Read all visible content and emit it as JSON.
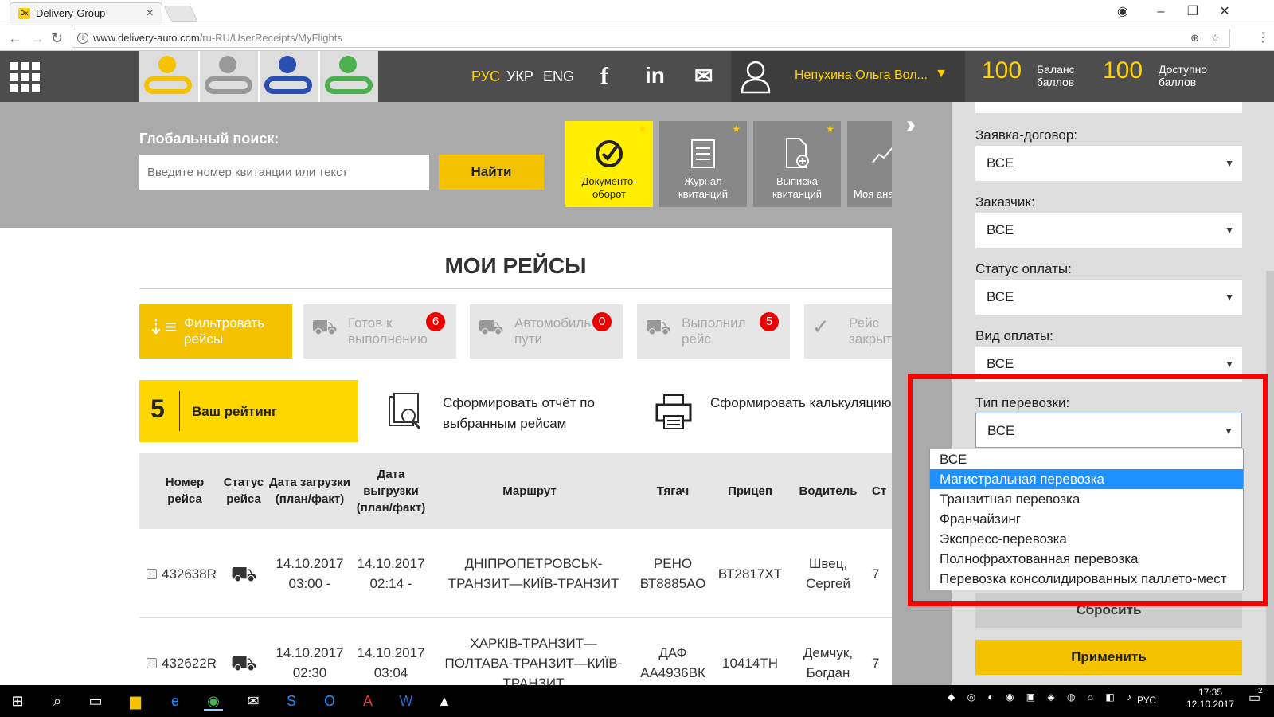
{
  "browser": {
    "tab_title": "Delivery-Group",
    "favicon": "Dx",
    "url_host": "www.delivery-auto.com",
    "url_path": "/ru-RU/UserReceipts/MyFlights"
  },
  "header": {
    "languages": [
      "РУС",
      "УКР",
      "ENG"
    ],
    "user_name": "Непухина Ольга Вол...",
    "balance_value": "100",
    "balance_label": "Баланс баллов",
    "available_value": "100",
    "available_label": "Доступно баллов"
  },
  "search": {
    "label": "Глобальный поиск:",
    "placeholder": "Введите номер квитанции или текст",
    "button": "Найти"
  },
  "tiles": [
    {
      "label": "Документо-оборот",
      "icon": "check-circle-icon"
    },
    {
      "label": "Журнал квитанций",
      "icon": "journal-icon"
    },
    {
      "label": "Выписка квитанций",
      "icon": "document-add-icon"
    },
    {
      "label": "Моя ана",
      "icon": "chart-icon"
    }
  ],
  "page_title": "МОИ РЕЙСЫ",
  "status_buttons": [
    {
      "label": "Фильтровать рейсы",
      "badge": ""
    },
    {
      "label": "Готов к выполнению",
      "badge": "6"
    },
    {
      "label": "Автомобиль в пути",
      "badge": "0"
    },
    {
      "label": "Выполнил рейс",
      "badge": "5"
    },
    {
      "label": "Рейс закрыт",
      "badge": ""
    }
  ],
  "rating": {
    "value": "5",
    "label": "Ваш рейтинг"
  },
  "actions": {
    "report": "Сформировать отчёт по выбранным рейсам",
    "calc": "Сформировать калькуляцию для счёта фактуры"
  },
  "table": {
    "headers": [
      "Номер рейса",
      "Статус рейса",
      "Дата загрузки (план/факт)",
      "Дата выгрузки (план/факт)",
      "Маршрут",
      "Тягач",
      "Прицеп",
      "Водитель",
      "Ст"
    ],
    "rows": [
      {
        "number": "432638R",
        "load": "14.10.2017 03:00 -",
        "unload": "14.10.2017 02:14 -",
        "route": "ДНІПРОПЕТРОВСЬК-ТРАНЗИТ—КИЇВ-ТРАНЗИТ",
        "tractor": "РЕНО ВТ8885АО",
        "trailer": "ВТ2817ХТ",
        "driver": "Швец, Сергей",
        "extra": "7"
      },
      {
        "number": "432622R",
        "load": "14.10.2017 02:30",
        "unload": "14.10.2017 03:04",
        "route": "ХАРКІВ-ТРАНЗИТ—ПОЛТАВА-ТРАНЗИТ—КИЇВ-ТРАНЗИТ",
        "tractor": "ДАФ АА4936ВК",
        "trailer": "10414ТН",
        "driver": "Демчук, Богдан",
        "extra": "7"
      }
    ]
  },
  "filter": {
    "fields": [
      {
        "label": "Заявка-договор:",
        "value": "ВСЕ"
      },
      {
        "label": "Заказчик:",
        "value": "ВСЕ"
      },
      {
        "label": "Статус оплаты:",
        "value": "ВСЕ"
      },
      {
        "label": "Вид оплаты:",
        "value": "ВСЕ"
      },
      {
        "label": "Тип перевозки:",
        "value": "ВСЕ"
      }
    ],
    "dropdown_options": [
      "ВСЕ",
      "Магистральная перевозка",
      "Транзитная перевозка",
      "Франчайзинг",
      "Экспресс-перевозка",
      "Полнофрахтованная перевозка",
      "Перевозка консолидированных паллето-мест"
    ],
    "selected_option_index": 1,
    "reset": "Сбросить",
    "apply": "Применить"
  },
  "taskbar": {
    "lang": "РУС",
    "time": "17:35",
    "date": "12.10.2017",
    "notif": "2"
  },
  "colors": {
    "accent": "#f5c200",
    "header_bg": "#4d4d4d",
    "highlight": "#ff0000",
    "selected_option": "#1e90ff"
  }
}
